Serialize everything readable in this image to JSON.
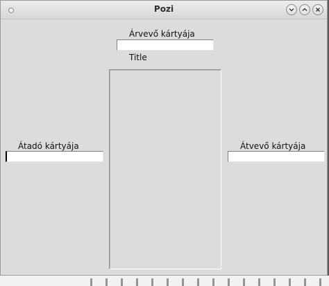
{
  "window": {
    "title": "Pozi"
  },
  "top_field": {
    "label": "Árvevő kártyája",
    "value": ""
  },
  "center": {
    "title_label": "Title",
    "content": ""
  },
  "left_field": {
    "label": "Átadó kártyája",
    "value": ""
  },
  "right_field": {
    "label": "Átvevő kártyája",
    "value": ""
  },
  "window_controls": {
    "minimize_icon": "chevron-down-icon",
    "maximize_icon": "chevron-up-icon",
    "close_icon": "close-icon"
  }
}
